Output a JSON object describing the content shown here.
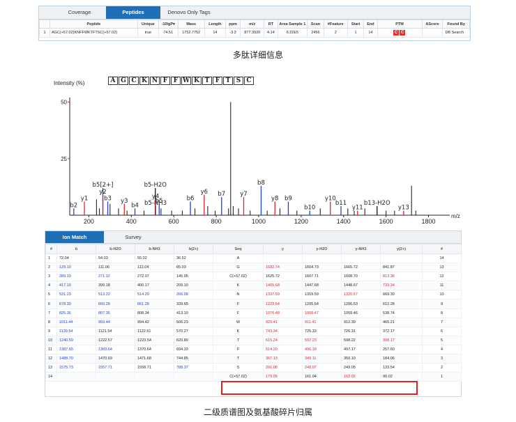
{
  "top": {
    "tabs": [
      "Coverage",
      "Peptides",
      "Denovo Only Tags"
    ],
    "active_tab": 1,
    "columns": [
      "",
      "Peptide",
      "Unique",
      "-10lgP▾",
      "Mass",
      "Length",
      "ppm",
      "m/z",
      "RT",
      "Area Sample 1",
      "Scan",
      "#Feature",
      "Start",
      "End",
      "PTM",
      "AScore",
      "Found By"
    ],
    "row": [
      "1",
      "AGC(+57.02)KNFFWKTFTSC(+57.02)",
      "true",
      "74.51",
      "1752.7752",
      "14",
      "-3.3",
      "877.3920",
      "4.14",
      "6.22E5",
      "2456",
      "2",
      "1",
      "14",
      "",
      "",
      "DB Search"
    ],
    "ptm_badges": [
      "C",
      "C"
    ],
    "ptm_color": "#e8312a"
  },
  "caption_top": "多肽详细信息",
  "caption_bottom": "二级质谱图及氨基酸碎片归属",
  "spectrum": {
    "y_axis_title": "Intensity (%)",
    "x_axis_unit": "m/z",
    "sequence": [
      "A",
      "G",
      "C",
      "K",
      "N",
      "F",
      "F",
      "W",
      "K",
      "T",
      "F",
      "T",
      "S",
      "C"
    ],
    "x_ticks": [
      "200",
      "400",
      "600",
      "800",
      "1000",
      "1200",
      "1400",
      "1600",
      "1800"
    ],
    "y_ticks": [
      "50",
      "25"
    ],
    "colors": {
      "b": "#1e3fd9",
      "y": "#e0232e",
      "other": "#111111"
    }
  },
  "chart_data": {
    "type": "bar",
    "title": "",
    "ylabel": "Intensity (%)",
    "xlabel": "m/z",
    "xlim": [
      110,
      1900
    ],
    "ylim": [
      0,
      52
    ],
    "annotated_peaks": [
      {
        "label": "b2",
        "mz": 129.1,
        "intensity": 3,
        "ion": "b"
      },
      {
        "label": "y1",
        "mz": 179.05,
        "intensity": 6,
        "ion": "y"
      },
      {
        "label": "b5[2+]",
        "mz": 266.1,
        "intensity": 12,
        "ion": "b"
      },
      {
        "label": "y2",
        "mz": 266.08,
        "intensity": 9,
        "ion": "y"
      },
      {
        "label": "b3",
        "mz": 289.1,
        "intensity": 6,
        "ion": "b"
      },
      {
        "label": "y3",
        "mz": 367.13,
        "intensity": 5,
        "ion": "y"
      },
      {
        "label": "b4",
        "mz": 417.19,
        "intensity": 3,
        "ion": "b"
      },
      {
        "label": "b5-H2O",
        "mz": 513.22,
        "intensity": 12,
        "ion": "other"
      },
      {
        "label": "b5",
        "mz": 531.23,
        "intensity": 5,
        "ion": "b"
      },
      {
        "label": "b5-NH3",
        "mz": 514.2,
        "intensity": 4,
        "ion": "other"
      },
      {
        "label": "y4",
        "mz": 514.2,
        "intensity": 7,
        "ion": "y"
      },
      {
        "label": "b6",
        "mz": 678.3,
        "intensity": 6,
        "ion": "b"
      },
      {
        "label": "y6",
        "mz": 743.34,
        "intensity": 9,
        "ion": "y"
      },
      {
        "label": "b7",
        "mz": 825.36,
        "intensity": 8,
        "ion": "b"
      },
      {
        "label": "y7",
        "mz": 929.41,
        "intensity": 8,
        "ion": "y"
      },
      {
        "label": "b8",
        "mz": 1011.44,
        "intensity": 13,
        "ion": "b"
      },
      {
        "label": "y8",
        "mz": 1076.48,
        "intensity": 6,
        "ion": "y"
      },
      {
        "label": "b9",
        "mz": 1139.54,
        "intensity": 6,
        "ion": "b"
      },
      {
        "label": "b10",
        "mz": 1240.59,
        "intensity": 2,
        "ion": "b"
      },
      {
        "label": "y10",
        "mz": 1337.59,
        "intensity": 6,
        "ion": "y"
      },
      {
        "label": "b11",
        "mz": 1387.65,
        "intensity": 4,
        "ion": "b"
      },
      {
        "label": "y11",
        "mz": 1465.68,
        "intensity": 2,
        "ion": "y"
      },
      {
        "label": "b13-H2O",
        "mz": 1557.71,
        "intensity": 4,
        "ion": "other"
      },
      {
        "label": "y13",
        "mz": 1682.74,
        "intensity": 2,
        "ion": "y"
      }
    ],
    "unlabeled_peaks": [
      {
        "mz": 236,
        "intensity": 7,
        "ion": "other"
      },
      {
        "mz": 250,
        "intensity": 3,
        "ion": "other"
      },
      {
        "mz": 300,
        "intensity": 5,
        "ion": "other"
      },
      {
        "mz": 340,
        "intensity": 3,
        "ion": "other"
      },
      {
        "mz": 380,
        "intensity": 2,
        "ion": "other"
      },
      {
        "mz": 460,
        "intensity": 2,
        "ion": "other"
      },
      {
        "mz": 540,
        "intensity": 3,
        "ion": "other"
      },
      {
        "mz": 590,
        "intensity": 2,
        "ion": "other"
      },
      {
        "mz": 640,
        "intensity": 2,
        "ion": "other"
      },
      {
        "mz": 700,
        "intensity": 3,
        "ion": "other"
      },
      {
        "mz": 760,
        "intensity": 4,
        "ion": "other"
      },
      {
        "mz": 795,
        "intensity": 2,
        "ion": "other"
      },
      {
        "mz": 858,
        "intensity": 3,
        "ion": "other"
      },
      {
        "mz": 868,
        "intensity": 50,
        "ion": "other"
      },
      {
        "mz": 880,
        "intensity": 4,
        "ion": "other"
      },
      {
        "mz": 905,
        "intensity": 3,
        "ion": "other"
      },
      {
        "mz": 960,
        "intensity": 2,
        "ion": "other"
      },
      {
        "mz": 1040,
        "intensity": 2,
        "ion": "other"
      },
      {
        "mz": 1100,
        "intensity": 3,
        "ion": "other"
      },
      {
        "mz": 1180,
        "intensity": 2,
        "ion": "other"
      },
      {
        "mz": 1290,
        "intensity": 3,
        "ion": "other"
      },
      {
        "mz": 1420,
        "intensity": 3,
        "ion": "other"
      },
      {
        "mz": 1450,
        "intensity": 2,
        "ion": "other"
      },
      {
        "mz": 1500,
        "intensity": 3,
        "ion": "other"
      },
      {
        "mz": 1600,
        "intensity": 2,
        "ion": "other"
      },
      {
        "mz": 1640,
        "intensity": 2,
        "ion": "other"
      },
      {
        "mz": 1720,
        "intensity": 13,
        "ion": "other"
      },
      {
        "mz": 1740,
        "intensity": 2,
        "ion": "other"
      }
    ]
  },
  "bottom": {
    "tabs": [
      "Ion Match",
      "Survey"
    ],
    "active_tab": 0,
    "columns": [
      "#",
      "b",
      "b-H2O",
      "b-NH3",
      "b(2+)",
      "Seq",
      "y",
      "y-H2O",
      "y-NH3",
      "y(2+)",
      "#"
    ],
    "rows": [
      [
        "1",
        "72.04",
        "54.03",
        "55.02",
        "36.52",
        "A",
        "",
        "",
        "",
        "",
        "14"
      ],
      [
        "2",
        "129.10",
        "111.06",
        "112.04",
        "65.03",
        "G",
        "1682.74",
        "1664.73",
        "1665.72",
        "841.87",
        "13"
      ],
      [
        "3",
        "289.10",
        "271.12",
        "272.07",
        "145.05",
        "C(+57.02)",
        "1625.72",
        "1607.71",
        "1608.70",
        "813.36",
        "12"
      ],
      [
        "4",
        "417.19",
        "399.18",
        "400.17",
        "209.10",
        "K",
        "1465.68",
        "1447.68",
        "1448.67",
        "733.34",
        "11"
      ],
      [
        "5",
        "531.23",
        "513.22",
        "514.20",
        "266.08",
        "N",
        "1337.59",
        "1319.59",
        "1320.57",
        "669.30",
        "10"
      ],
      [
        "6",
        "678.30",
        "660.28",
        "661.28",
        "339.65",
        "F",
        "1223.54",
        "1205.54",
        "1206.53",
        "612.28",
        "9"
      ],
      [
        "7",
        "825.36",
        "807.35",
        "808.34",
        "413.19",
        "F",
        "1076.48",
        "1058.47",
        "1059.46",
        "538.74",
        "8"
      ],
      [
        "8",
        "1011.44",
        "993.44",
        "994.42",
        "506.23",
        "W",
        "929.41",
        "911.41",
        "912.39",
        "465.21",
        "7"
      ],
      [
        "9",
        "1139.54",
        "1121.54",
        "1122.51",
        "570.27",
        "K",
        "743.34",
        "725.33",
        "726.31",
        "372.17",
        "6"
      ],
      [
        "10",
        "1240.59",
        "1222.57",
        "1223.54",
        "620.80",
        "T",
        "615.24",
        "597.23",
        "598.22",
        "308.17",
        "5"
      ],
      [
        "11",
        "1387.65",
        "1369.64",
        "1370.64",
        "694.33",
        "F",
        "514.20",
        "496.18",
        "497.17",
        "257.60",
        "4"
      ],
      [
        "12",
        "1488.70",
        "1470.69",
        "1471.68",
        "744.85",
        "T",
        "367.13",
        "349.11",
        "350.10",
        "184.06",
        "3"
      ],
      [
        "13",
        "1575.73",
        "1557.71",
        "1558.71",
        "788.37",
        "S",
        "266.08",
        "248.07",
        "249.05",
        "133.54",
        "2"
      ],
      [
        "14",
        "",
        "",
        "",
        "",
        "C(+57.02)",
        "179.05",
        "161.04",
        "162.02",
        "90.02",
        "1"
      ]
    ],
    "blue_cells": [
      [
        1,
        1
      ],
      [
        2,
        1
      ],
      [
        2,
        2
      ],
      [
        3,
        1
      ],
      [
        4,
        1
      ],
      [
        4,
        2
      ],
      [
        4,
        3
      ],
      [
        4,
        4
      ],
      [
        5,
        1
      ],
      [
        5,
        2
      ],
      [
        5,
        3
      ],
      [
        6,
        1
      ],
      [
        6,
        2
      ],
      [
        7,
        1
      ],
      [
        7,
        2
      ],
      [
        8,
        1
      ],
      [
        9,
        1
      ],
      [
        10,
        1
      ],
      [
        10,
        2
      ],
      [
        11,
        1
      ],
      [
        12,
        1
      ],
      [
        12,
        2
      ],
      [
        12,
        4
      ]
    ],
    "red_cells": [
      [
        1,
        6
      ],
      [
        2,
        9
      ],
      [
        3,
        6
      ],
      [
        3,
        9
      ],
      [
        4,
        6
      ],
      [
        4,
        8
      ],
      [
        5,
        6
      ],
      [
        6,
        6
      ],
      [
        6,
        7
      ],
      [
        7,
        6
      ],
      [
        7,
        7
      ],
      [
        8,
        6
      ],
      [
        9,
        6
      ],
      [
        9,
        7
      ],
      [
        9,
        9
      ],
      [
        10,
        6
      ],
      [
        10,
        7
      ],
      [
        11,
        6
      ],
      [
        11,
        7
      ],
      [
        12,
        6
      ],
      [
        12,
        7
      ],
      [
        13,
        6
      ],
      [
        13,
        8
      ]
    ],
    "highlight_row": 13,
    "highlight_color": "#e01f26"
  }
}
